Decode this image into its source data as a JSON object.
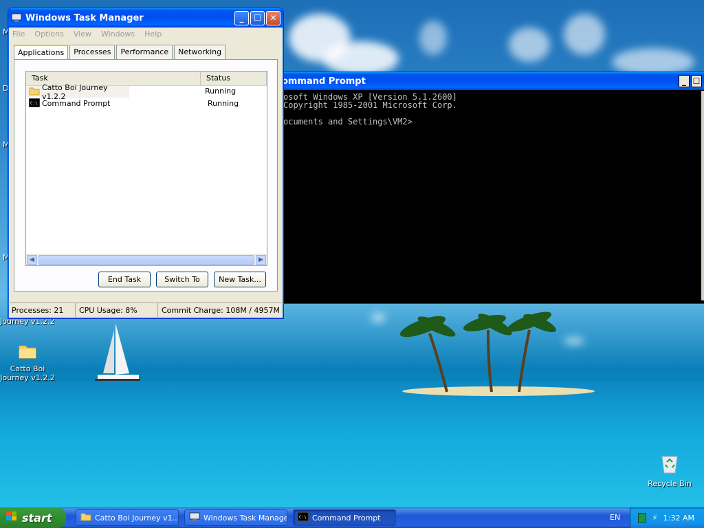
{
  "desktop": {
    "icons": [
      {
        "label": "Catto Boi\nJourney v1.2.2",
        "icon": "folder-icon"
      },
      {
        "label": "Journey v1.2.2",
        "icon": "folder-icon"
      },
      {
        "label": "Recycle Bin",
        "icon": "recycle-bin-icon"
      }
    ],
    "left_edge_letters": [
      "M",
      "D",
      "M",
      "M"
    ]
  },
  "task_manager": {
    "title": "Windows Task Manager",
    "menu": [
      "File",
      "Options",
      "View",
      "Windows",
      "Help"
    ],
    "tabs": [
      "Applications",
      "Processes",
      "Performance",
      "Networking"
    ],
    "active_tab": "Applications",
    "columns": [
      "Task",
      "Status"
    ],
    "tasks": [
      {
        "name": "Catto Boi Journey v1.2.2",
        "status": "Running",
        "icon": "folder-icon"
      },
      {
        "name": "Command Prompt",
        "status": "Running",
        "icon": "cmd-icon"
      }
    ],
    "buttons": {
      "end_task": "End Task",
      "switch_to": "Switch To",
      "new_task": "New Task..."
    },
    "status": {
      "processes": "Processes: 21",
      "cpu": "CPU Usage: 8%",
      "commit": "Commit Charge: 108M / 4957M"
    }
  },
  "cmd": {
    "title": "ommand Prompt",
    "lines": [
      "osoft Windows XP [Version 5.1.2600]",
      "Copyright 1985-2001 Microsoft Corp.",
      "",
      "ocuments and Settings\\VM2>"
    ]
  },
  "taskbar": {
    "start_label": "start",
    "items": [
      {
        "label": "Catto Boi Journey v1...",
        "icon": "folder-icon"
      },
      {
        "label": "Windows Task Manager",
        "icon": "task-manager-icon"
      },
      {
        "label": "Command Prompt",
        "icon": "cmd-icon"
      }
    ],
    "language": "EN",
    "clock": "1:32 AM"
  }
}
